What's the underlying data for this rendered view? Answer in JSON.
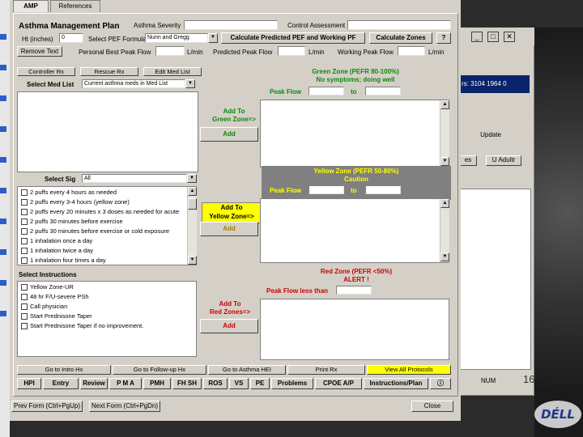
{
  "tabs": {
    "amp": "AMP",
    "references": "References"
  },
  "header": {
    "title": "Asthma Management Plan",
    "asthma_severity_label": "Asthma Severity",
    "control_assessment_label": "Control Assessment",
    "ht_label": "Ht (inches)",
    "ht_value": "0",
    "pef_formula_label": "Select PEF Formula",
    "pef_formula_value": "Nunn and Gregg",
    "calc_predicted_button": "Calculate Predicted PEF and Working PF",
    "calc_zones_button": "Calculate Zones",
    "help_button": "?",
    "remove_text_button": "Remove Text",
    "personal_best_label": "Personal Best Peak Flow",
    "predicted_label": "Predicted Peak Flow",
    "working_label": "Working Peak Flow",
    "unit": "L/min"
  },
  "left": {
    "controller_rx": "Controller Rx",
    "rescue_rx": "Rescue Rx",
    "edit_med_list": "Edit Med List",
    "select_med_list_label": "Select Med List",
    "med_list_value": "Current asthma meds in Med List",
    "select_sig_label": "Select Sig",
    "sig_value": "All",
    "sig_items": [
      "2 puffs every 4 hours as needed",
      "2 puffs every 3-4 hours (yellow zone)",
      "2 puffs every 20 minutes x 3 doses as needed for acute",
      "2 puffs 30 minutes before exercise",
      "2 puffs 30 minutes before exercise or cold exposure",
      "1 inhalation once a day",
      "1 inhalation twice a day",
      "1 inhalation four times a day"
    ],
    "select_instructions_label": "Select Instructions",
    "instruction_items": [
      "Yellow Zone-UR",
      "48 hr F/U-severe PSh",
      "Call physician",
      "Start Prednisone Taper",
      "Start Prednisone Taper if no improvement."
    ]
  },
  "middle": {
    "add_to_green": "Add To\nGreen Zone=>",
    "add_to_yellow": "Add To\nYellow Zone=>",
    "add_to_red": "Add To\nRed Zones=>",
    "add": "Add"
  },
  "zones": {
    "green_title": "Green Zone (PEFR 80-100%)",
    "green_sub": "No symptoms; doing well",
    "yellow_title": "Yellow Zone (PEFR 50-80%)",
    "yellow_sub": "Caution",
    "red_title": "Red Zone (PEFR <50%)",
    "red_sub": "ALERT !",
    "peak_flow": "Peak Flow",
    "to": "to",
    "peak_flow_less": "Peak Flow less than"
  },
  "nav_row1": [
    "Go to Intro Hx",
    "Go to Follow-up Hx",
    "Go to Asthma HEI",
    "Print Rx",
    "View All Protocols"
  ],
  "nav_row2": [
    "HPI",
    "Entry",
    "Review",
    "P M A",
    "PMH",
    "FH SH",
    "ROS",
    "VS",
    "PE",
    "Problems",
    "CPOE A/P",
    "Instructions/Plan",
    "ⓘ"
  ],
  "footer": {
    "prev_form": "Prev Form (Ctrl+PgUp)",
    "next_form": "Next Form (Ctrl+PgDn)",
    "close": "Close"
  },
  "background": {
    "blue_text": "rs: 3104 1964 0",
    "tab_update": "Update",
    "btn_es": "es",
    "btn_add": "U Adultr",
    "num": "NUM",
    "slide_num": "16",
    "logo": "DÉLL"
  }
}
